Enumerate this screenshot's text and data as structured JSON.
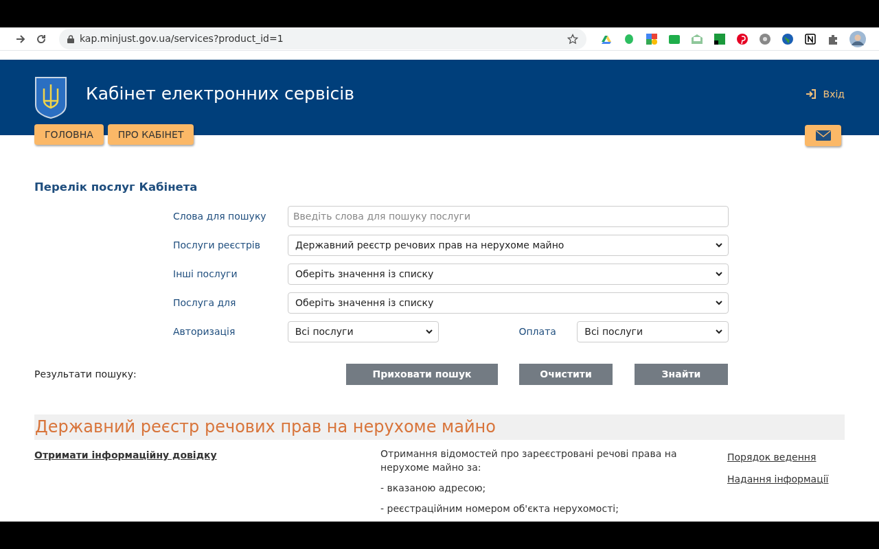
{
  "browser": {
    "url": "kap.minjust.gov.ua/services?product_id=1"
  },
  "header": {
    "title": "Кабінет електронних сервісів",
    "login": "Вхід"
  },
  "nav": [
    "ГОЛОВНА",
    "ПРО КАБІНЕТ"
  ],
  "section_title": "Перелік послуг Кабінета",
  "form": {
    "rows": [
      {
        "label": "Слова для пошуку",
        "kind": "text",
        "placeholder": "Введіть слова для пошуку послуги"
      },
      {
        "label": "Послуги реєстрів",
        "kind": "select",
        "value": "Державний реєстр речових прав на нерухоме майно"
      },
      {
        "label": "Інші послуги",
        "kind": "select",
        "value": "Оберіть значення із списку"
      },
      {
        "label": "Послуга для",
        "kind": "select",
        "value": "Оберіть значення із списку"
      }
    ],
    "filters": [
      {
        "label": "Авторизація",
        "value": "Всі послуги"
      },
      {
        "label": "Оплата",
        "value": "Всі послуги"
      }
    ]
  },
  "results_label": "Результати пошуку:",
  "buttons": [
    "Приховати пошук",
    "Очистити",
    "Знайти"
  ],
  "registry": {
    "title": "Державний реєстр речових прав на нерухоме майно",
    "link": "Отримати інформаційну довідку",
    "description": [
      "Отримання відомостей про зареєстровані речові права на нерухоме майно за:",
      "- вказаною адресою;",
      "- реєстраційним номером об'єкта нерухомості;"
    ],
    "side_links": [
      "Порядок ведення",
      "Надання інформації"
    ]
  }
}
